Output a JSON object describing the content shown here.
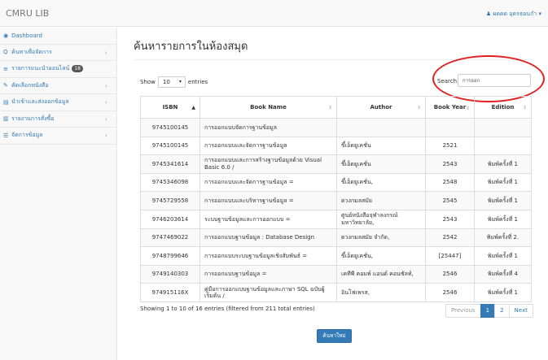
{
  "app": {
    "title": "CMRU LIB",
    "user": "ผดดด อุดรธอนกำ"
  },
  "sidebar": {
    "items": [
      {
        "icon": "◉",
        "label": "Dashboard",
        "arrow": ""
      },
      {
        "icon": "Q",
        "label": "ค้นหาเพื่อจัดการ",
        "arrow": "‹"
      },
      {
        "icon": "≡",
        "label": "รายการแนะนำออนไลน์",
        "badge": "18",
        "arrow": ""
      },
      {
        "icon": "✎",
        "label": "คัดเลือกหนังสือ",
        "arrow": "‹"
      },
      {
        "icon": "▤",
        "label": "นำเข้าและส่งออกข้อมูล",
        "arrow": "‹"
      },
      {
        "icon": "▥",
        "label": "รายงานการสั่งซื้อ",
        "arrow": "‹"
      },
      {
        "icon": "☰",
        "label": "จัดการข้อมูล",
        "arrow": "‹"
      }
    ]
  },
  "main": {
    "title": "ค้นหารายการในห้องสมุด",
    "show_label": "Show",
    "entries_label": "entries",
    "page_length": "10",
    "search_label": "Search:",
    "search_value": "การออก",
    "columns": {
      "isbn": "ISBN",
      "book_name": "Book Name",
      "author": "Author",
      "book_year": "Book Year",
      "edition": "Edition"
    },
    "rows": [
      {
        "isbn": "9745100145",
        "name": "การออกแบบจัดการฐานข้อมูล",
        "author": "",
        "year": "",
        "edition": ""
      },
      {
        "isbn": "9745100145",
        "name": "การออกแบบและจัดการฐานข้อมูล",
        "author": "ขึ้เอ็ดยูเคชั่น",
        "year": "2521",
        "edition": ""
      },
      {
        "isbn": "9745341614",
        "name": "การออกแบบและการสร้างฐานข้อมูลด้วย Visual Basic 6.0 /",
        "author": "ขึ้เอ็ดยูเคชั่น",
        "year": "2543",
        "edition": "พิมพ์ครั้งที่ 1"
      },
      {
        "isbn": "9745346098",
        "name": "การออกแบบและจัดการฐานข้อมูล =",
        "author": "ขึ้เอ็ดยูเคชั่น,",
        "year": "2548",
        "edition": "พิมพ์ครั้งที่ 1"
      },
      {
        "isbn": "9745729558",
        "name": "การออกแบบและบริหารฐานข้อมูล =",
        "author": "ดวงกมลสมัย",
        "year": "2545",
        "edition": "พิมพ์ครั้งที่ 1"
      },
      {
        "isbn": "9746203614",
        "name": "ระบบฐานข้อมูลและการออกแบบ =",
        "author": "ศูนย์หนังสือจุฬาลงกรณ์มหาวิทยาลัย,",
        "year": "2543",
        "edition": "พิมพ์ครั้งที่ 1"
      },
      {
        "isbn": "9747469022",
        "name": "การออกแบบฐานข้อมูล : Database Design",
        "author": "ดวงกมลสมัย จำกัด,",
        "year": "2542",
        "edition": "พิมพ์ครั้งที่ 2."
      },
      {
        "isbn": "9748799646",
        "name": "การออกแบบระบบฐานข้อมูลเชิงสัมพันธ์ =",
        "author": "ขึ้เอ็ดยูเคชั่น,",
        "year": "[25447]",
        "edition": "พิมพ์ครั้งที่ 1"
      },
      {
        "isbn": "9749140303",
        "name": "การออกแบบฐานข้อมูล =",
        "author": "เคทีพี คอมพ์ แอนด์ คอนซัลท์,",
        "year": "2546",
        "edition": "พิมพ์ครั้งที่ 4"
      },
      {
        "isbn": "974915116X",
        "name": "คู่มือการออกแบบฐานข้อมูลและภาษา SQL ฉบับผู้เริ่มต้น /",
        "author": "อินโฟเพรส,",
        "year": "2546",
        "edition": "พิมพ์ครั้งที่ 1"
      }
    ],
    "info": "Showing 1 to 10 of 16 entries (filtered from 211 total entries)",
    "pager": {
      "previous": "Previous",
      "page1": "1",
      "page2": "2",
      "next": "Next"
    },
    "search_button": "ค้นหาใหม่"
  },
  "colors": {
    "accent": "#337ab7",
    "highlight": "#e02020"
  }
}
